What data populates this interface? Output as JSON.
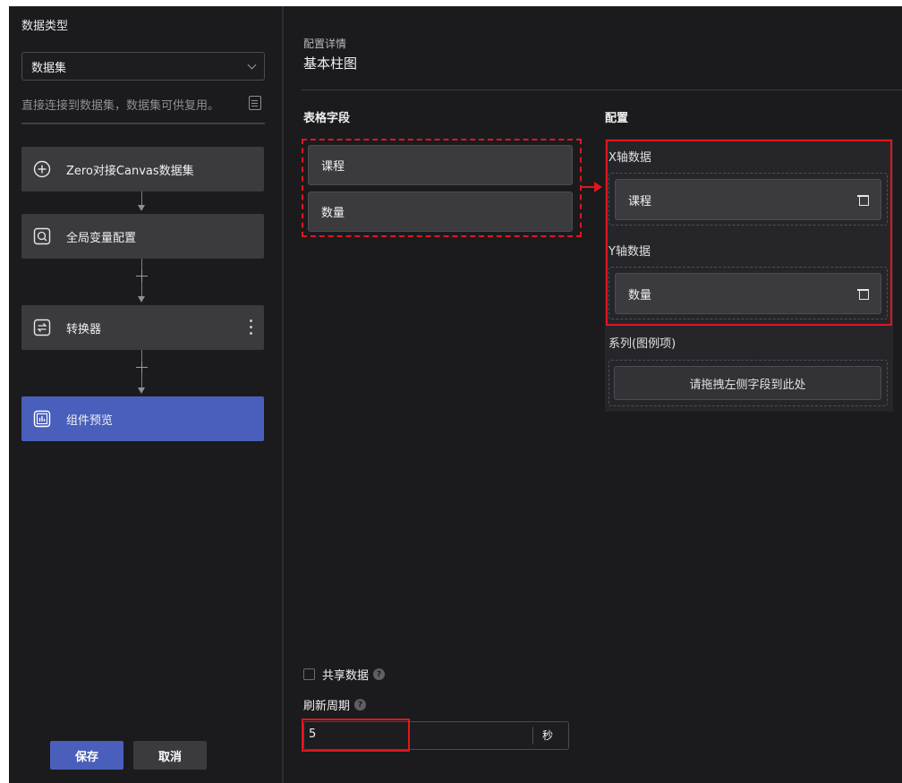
{
  "left_panel": {
    "data_type_label": "数据类型",
    "select_value": "数据集",
    "description": "直接连接到数据集，数据集可供复用。",
    "steps": [
      {
        "label": "Zero对接Canvas数据集",
        "icon": "plus-circle-icon"
      },
      {
        "label": "全局变量配置",
        "icon": "global-variable-icon"
      },
      {
        "label": "转换器",
        "icon": "converter-icon"
      },
      {
        "label": "组件预览",
        "icon": "chart-preview-icon",
        "active": true
      }
    ],
    "save_label": "保存",
    "cancel_label": "取消"
  },
  "config": {
    "subtitle": "配置详情",
    "title": "基本柱图",
    "table_fields_title": "表格字段",
    "table_fields": [
      "课程",
      "数量"
    ],
    "config_title": "配置",
    "x_axis_label": "X轴数据",
    "x_axis_items": [
      "课程"
    ],
    "y_axis_label": "Y轴数据",
    "y_axis_items": [
      "数量"
    ],
    "series_label": "系列(图例项)",
    "series_placeholder": "请拖拽左侧字段到此处"
  },
  "bottom": {
    "share_data_label": "共享数据",
    "share_data_checked": false,
    "refresh_label": "刷新周期",
    "refresh_value": "5",
    "refresh_unit": "秒"
  },
  "colors": {
    "background": "#1b1b1e",
    "accent": "#4a5fbb",
    "highlight": "#e0161f"
  }
}
